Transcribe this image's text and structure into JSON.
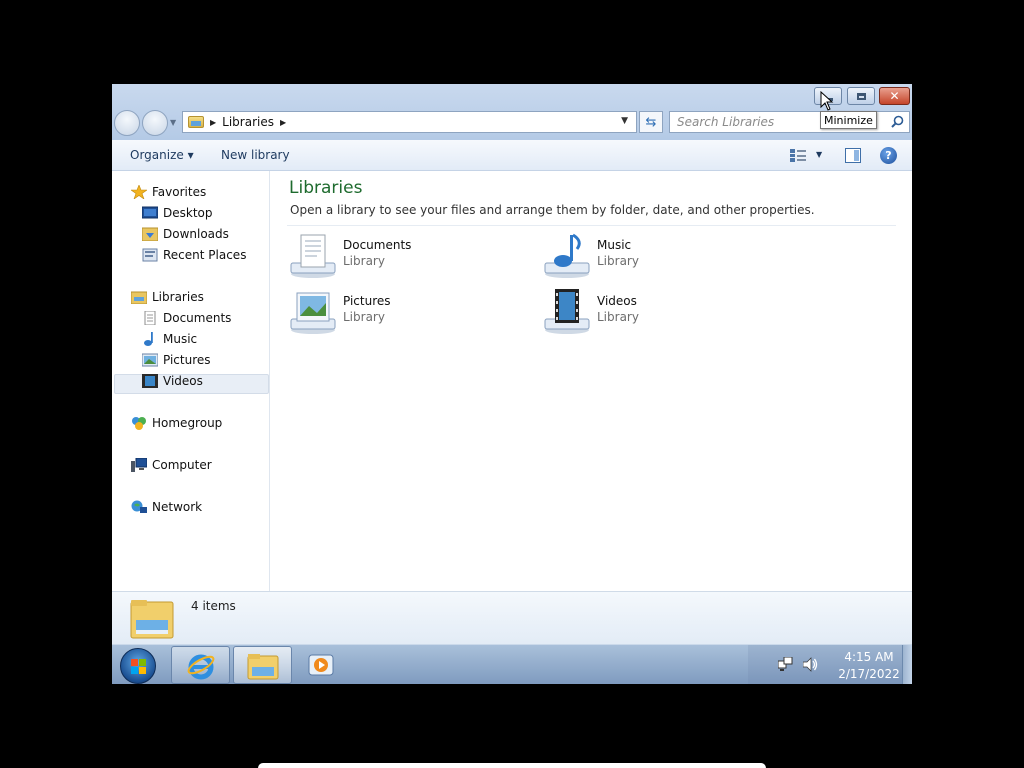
{
  "window": {
    "address_path": "Libraries",
    "search_placeholder": "Search Libraries",
    "tooltip": "Minimize"
  },
  "toolbar": {
    "organize_label": "Organize ▾",
    "new_library_label": "New library"
  },
  "nav": {
    "favorites": "Favorites",
    "desktop": "Desktop",
    "downloads": "Downloads",
    "recent_places": "Recent Places",
    "libraries": "Libraries",
    "documents": "Documents",
    "music": "Music",
    "pictures": "Pictures",
    "videos": "Videos",
    "homegroup": "Homegroup",
    "computer": "Computer",
    "network": "Network"
  },
  "content": {
    "title": "Libraries",
    "description": "Open a library to see your files and arrange them by folder, date, and other properties.",
    "libraries": [
      {
        "name": "Documents",
        "type": "Library",
        "icon": "documents-library-icon"
      },
      {
        "name": "Music",
        "type": "Library",
        "icon": "music-library-icon"
      },
      {
        "name": "Pictures",
        "type": "Library",
        "icon": "pictures-library-icon"
      },
      {
        "name": "Videos",
        "type": "Library",
        "icon": "videos-library-icon"
      }
    ]
  },
  "details": {
    "items_count": "4 items"
  },
  "taskbar": {
    "time": "4:15 AM",
    "date": "2/17/2022"
  },
  "colors": {
    "title_green": "#1e6b2e",
    "link_blue": "#1e3a5f",
    "taskbar": "#7f9bbf"
  }
}
